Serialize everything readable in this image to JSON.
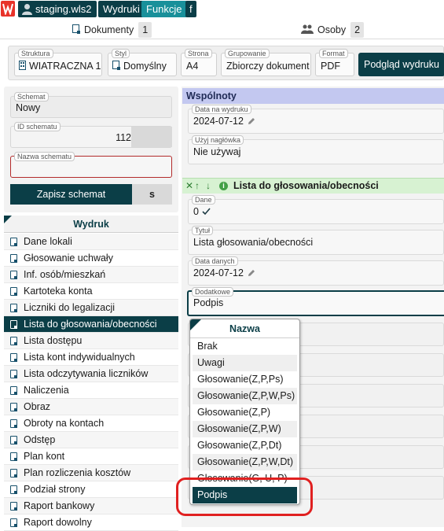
{
  "topbar": {
    "host": "staging.wls2",
    "wydruki": "Wydruki",
    "funkcje": "Funkcje",
    "f": "f"
  },
  "tabs": [
    {
      "label": "Dokumenty",
      "count": "1"
    },
    {
      "label": "Osoby",
      "count": "2"
    }
  ],
  "toolbar": {
    "struktura": {
      "label": "Struktura",
      "value": "WIATRACZNA 1"
    },
    "styl": {
      "label": "Styl",
      "value": "Domyślny"
    },
    "strona": {
      "label": "Strona",
      "value": "A4"
    },
    "grupowanie": {
      "label": "Grupowanie",
      "value": "Zbiorczy dokument"
    },
    "format": {
      "label": "Format",
      "value": "PDF"
    },
    "preview_label": "Podgląd wydruku"
  },
  "schema": {
    "schemat_label": "Schemat",
    "schemat_value": "Nowy",
    "id_label": "ID schematu",
    "id_value": "112",
    "nazwa_label": "Nazwa schematu",
    "save_label": "Zapisz schemat",
    "s_label": "s"
  },
  "wydruk": {
    "title": "Wydruk",
    "items": [
      {
        "label": "Dane lokali"
      },
      {
        "label": "Głosowanie uchwały"
      },
      {
        "label": "Inf. osób/mieszkań"
      },
      {
        "label": "Kartoteka konta"
      },
      {
        "label": "Liczniki do legalizacji"
      },
      {
        "label": "Lista do głosowania/obecności"
      },
      {
        "label": "Lista dostępu"
      },
      {
        "label": "Lista kont indywidualnych"
      },
      {
        "label": "Lista odczytywania liczników"
      },
      {
        "label": "Naliczenia"
      },
      {
        "label": "Obraz"
      },
      {
        "label": "Obroty na kontach"
      },
      {
        "label": "Odstęp"
      },
      {
        "label": "Plan kont"
      },
      {
        "label": "Plan rozliczenia kosztów"
      },
      {
        "label": "Podział strony"
      },
      {
        "label": "Raport bankowy"
      },
      {
        "label": "Raport dowolny"
      }
    ]
  },
  "wspolnoty": {
    "title": "Wspólnoty",
    "data_label": "Data na wydruku",
    "data_value": "2024-07-12",
    "naglowek_label": "Użyj nagłówka",
    "naglowek_value": "Nie używaj"
  },
  "lista": {
    "title": "Lista do głosowania/obecności",
    "dane_label": "Dane",
    "dane_value": "0",
    "tytul_label": "Tytuł",
    "tytul_value": "Lista głosowania/obecności",
    "data_danych_label": "Data danych",
    "data_danych_value": "2024-07-12",
    "dodatkowe_label": "Dodatkowe",
    "dodatkowe_value": "Podpis"
  },
  "dropdown": {
    "header": "Nazwa",
    "options": [
      {
        "label": "Brak"
      },
      {
        "label": "Uwagi"
      },
      {
        "label": "Głosowanie(Z,P,Ps)"
      },
      {
        "label": "Głosowanie(Z,P,W,Ps)"
      },
      {
        "label": "Głosowanie(Z,P)"
      },
      {
        "label": "Głosowanie(Z,P,W)"
      },
      {
        "label": "Głosowanie(Z,P,Dt)"
      },
      {
        "label": "Głosowanie(Z,P,W,Dt)"
      },
      {
        "label": "Głosowanie(G, U, P)"
      },
      {
        "label": "Podpis"
      }
    ],
    "selected": "Podpis"
  },
  "colors": {
    "primary": "#0b3e47",
    "accent": "#19909a",
    "wspolnoty_header": "#c3c8f0",
    "lista_header": "#d7f2d2",
    "highlight": "#e02020"
  }
}
